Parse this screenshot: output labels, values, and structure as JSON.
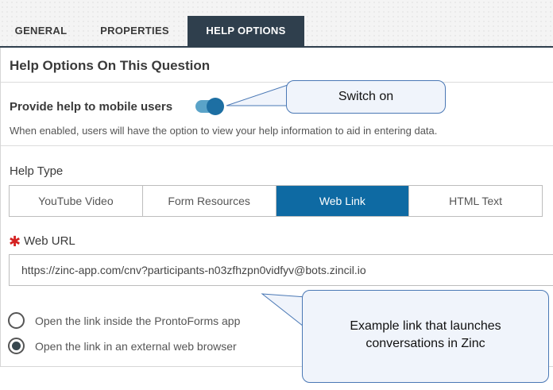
{
  "tabs": [
    {
      "label": "GENERAL",
      "active": false
    },
    {
      "label": "PROPERTIES",
      "active": false
    },
    {
      "label": "HELP OPTIONS",
      "active": true
    }
  ],
  "section_title": "Help Options On This Question",
  "mobile_help": {
    "label": "Provide help to mobile users",
    "enabled": true,
    "description": "When enabled, users will have the option to view your help information to aid in entering data."
  },
  "help_type": {
    "label": "Help Type",
    "options": [
      "YouTube Video",
      "Form Resources",
      "Web Link",
      "HTML Text"
    ],
    "selected": "Web Link"
  },
  "web_url": {
    "required_marker": "✱",
    "label": "Web URL",
    "value": "https://zinc-app.com/cnv?participants-n03zfhzpn0vidfyv@bots.zincil.io"
  },
  "open_options": [
    {
      "label": "Open the link inside the ProntoForms app",
      "selected": false
    },
    {
      "label": "Open the link in an external web browser",
      "selected": true
    }
  ],
  "callouts": {
    "switch": "Switch on",
    "example_line1": "Example link that launches",
    "example_line2": "conversations in Zinc"
  },
  "colors": {
    "tab_active": "#2f3f4d",
    "accent": "#0e6aa3",
    "toggle_track": "#5aa3c8",
    "toggle_knob": "#1d6fa3",
    "required": "#d42222",
    "callout_border": "#4a78b5"
  }
}
